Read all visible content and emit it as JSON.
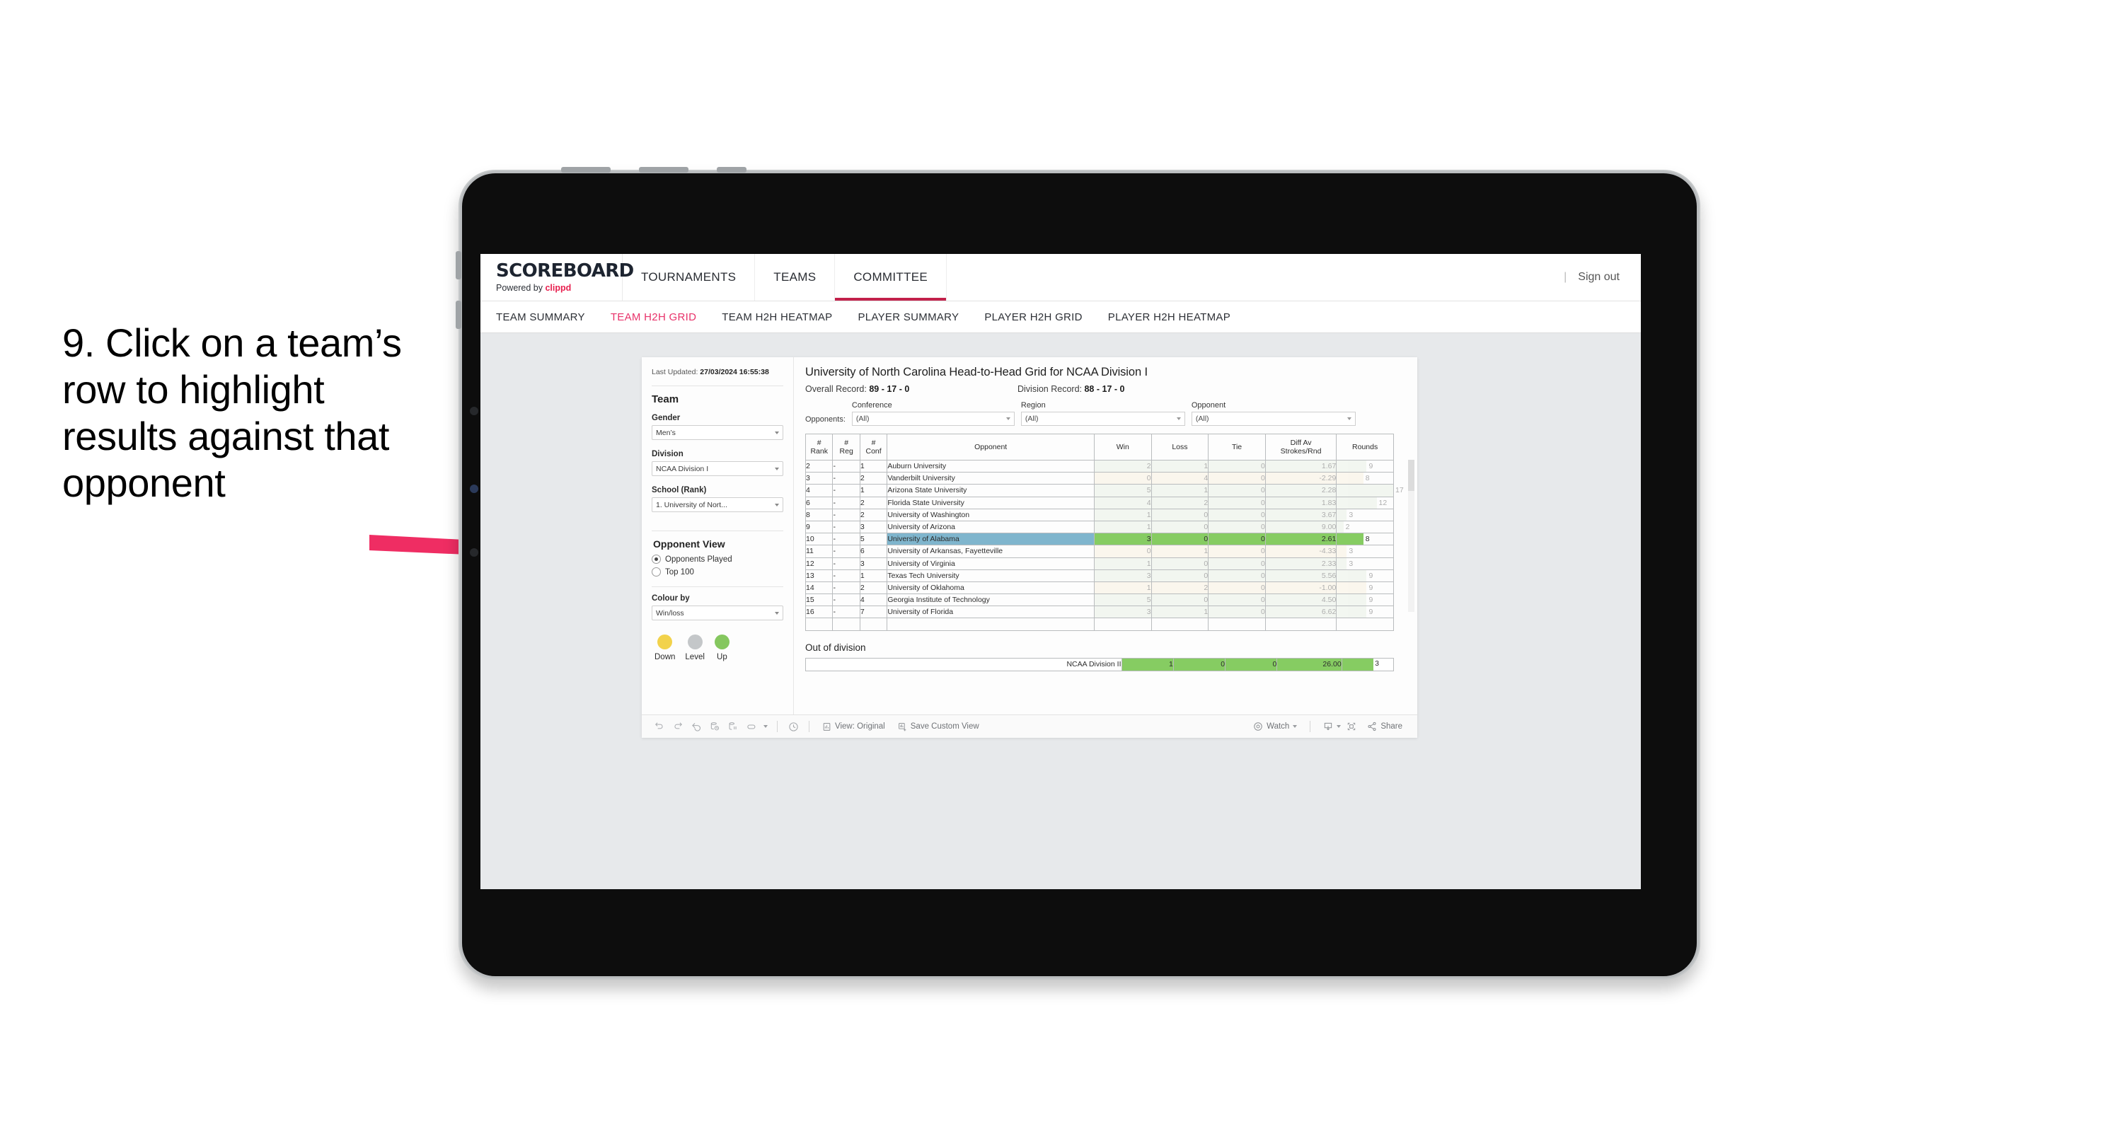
{
  "annotation": {
    "text": "9. Click on a team’s row to highlight results against that opponent"
  },
  "topnav": {
    "brand_title": "SCOREBOARD",
    "brand_sub_prefix": "Powered by ",
    "brand_sub_name": "clippd",
    "items": [
      {
        "label": "TOURNAMENTS",
        "active": false
      },
      {
        "label": "TEAMS",
        "active": false
      },
      {
        "label": "COMMITTEE",
        "active": true
      }
    ],
    "divider": "|",
    "sign_out": "Sign out"
  },
  "subnav": {
    "items": [
      {
        "label": "TEAM SUMMARY",
        "active": false
      },
      {
        "label": "TEAM H2H GRID",
        "active": true
      },
      {
        "label": "TEAM H2H HEATMAP",
        "active": false
      },
      {
        "label": "PLAYER SUMMARY",
        "active": false
      },
      {
        "label": "PLAYER H2H GRID",
        "active": false
      },
      {
        "label": "PLAYER H2H HEATMAP",
        "active": false
      }
    ]
  },
  "sidebar": {
    "last_updated_label": "Last Updated: ",
    "last_updated_value": "27/03/2024 16:55:38",
    "team_heading": "Team",
    "gender_label": "Gender",
    "gender_value": "Men’s",
    "division_label": "Division",
    "division_value": "NCAA Division I",
    "school_label": "School (Rank)",
    "school_value": "1. University of Nort...",
    "opponent_view_heading": "Opponent View",
    "opponent_view_options": [
      {
        "label": "Opponents Played",
        "selected": true
      },
      {
        "label": "Top 100",
        "selected": false
      }
    ],
    "colour_by_label": "Colour by",
    "colour_by_value": "Win/loss",
    "legend": [
      {
        "label": "Down",
        "color": "#f2d24b"
      },
      {
        "label": "Level",
        "color": "#c4c7c9"
      },
      {
        "label": "Up",
        "color": "#85c75f"
      }
    ]
  },
  "main": {
    "title": "University of North Carolina Head-to-Head Grid for NCAA Division I",
    "overall_record_label": "Overall Record: ",
    "overall_record_value": "89 - 17 - 0",
    "division_record_label": "Division Record: ",
    "division_record_value": "88 - 17 - 0",
    "opponents_label": "Opponents:",
    "filters": [
      {
        "label": "Conference",
        "value": "(All)"
      },
      {
        "label": "Region",
        "value": "(All)"
      },
      {
        "label": "Opponent",
        "value": "(All)"
      }
    ],
    "out_of_division_title": "Out of division",
    "out_of_division_row": {
      "label": "NCAA Division II",
      "win": "1",
      "loss": "0",
      "tie": "0",
      "diff": "26.00",
      "rounds": "3"
    }
  },
  "chart_data": {
    "type": "table",
    "title": "University of North Carolina Head-to-Head Grid for NCAA Division I",
    "columns": [
      "# Rank",
      "# Reg",
      "# Conf",
      "Opponent",
      "Win",
      "Loss",
      "Tie",
      "Diff Av Strokes/Rnd",
      "Rounds"
    ],
    "column_header_lines": [
      [
        "#",
        "Rank"
      ],
      [
        "#",
        "Reg"
      ],
      [
        "#",
        "Conf"
      ],
      [
        "Opponent"
      ],
      [
        "Win"
      ],
      [
        "Loss"
      ],
      [
        "Tie"
      ],
      [
        "Diff Av",
        "Strokes/Rnd"
      ],
      [
        "Rounds"
      ]
    ],
    "rows": [
      {
        "rank": "2",
        "reg": "-",
        "conf": "1",
        "opponent": "Auburn University",
        "win": "2",
        "loss": "1",
        "tie": "0",
        "diff": "1.67",
        "rounds": "9",
        "tone": "green",
        "selected": false
      },
      {
        "rank": "3",
        "reg": "-",
        "conf": "2",
        "opponent": "Vanderbilt University",
        "win": "0",
        "loss": "4",
        "tie": "0",
        "diff": "-2.29",
        "rounds": "8",
        "tone": "yellow",
        "selected": false
      },
      {
        "rank": "4",
        "reg": "-",
        "conf": "1",
        "opponent": "Arizona State University",
        "win": "5",
        "loss": "1",
        "tie": "0",
        "diff": "2.28",
        "rounds": "17",
        "tone": "green",
        "selected": false
      },
      {
        "rank": "6",
        "reg": "-",
        "conf": "2",
        "opponent": "Florida State University",
        "win": "4",
        "loss": "2",
        "tie": "0",
        "diff": "1.83",
        "rounds": "12",
        "tone": "green",
        "selected": false
      },
      {
        "rank": "8",
        "reg": "-",
        "conf": "2",
        "opponent": "University of Washington",
        "win": "1",
        "loss": "0",
        "tie": "0",
        "diff": "3.67",
        "rounds": "3",
        "tone": "green",
        "selected": false
      },
      {
        "rank": "9",
        "reg": "-",
        "conf": "3",
        "opponent": "University of Arizona",
        "win": "1",
        "loss": "0",
        "tie": "0",
        "diff": "9.00",
        "rounds": "2",
        "tone": "green",
        "selected": false
      },
      {
        "rank": "10",
        "reg": "-",
        "conf": "5",
        "opponent": "University of Alabama",
        "win": "3",
        "loss": "0",
        "tie": "0",
        "diff": "2.61",
        "rounds": "8",
        "tone": "selected",
        "selected": true
      },
      {
        "rank": "11",
        "reg": "-",
        "conf": "6",
        "opponent": "University of Arkansas, Fayetteville",
        "win": "0",
        "loss": "1",
        "tie": "0",
        "diff": "-4.33",
        "rounds": "3",
        "tone": "yellow",
        "selected": false
      },
      {
        "rank": "12",
        "reg": "-",
        "conf": "3",
        "opponent": "University of Virginia",
        "win": "1",
        "loss": "0",
        "tie": "0",
        "diff": "2.33",
        "rounds": "3",
        "tone": "green",
        "selected": false
      },
      {
        "rank": "13",
        "reg": "-",
        "conf": "1",
        "opponent": "Texas Tech University",
        "win": "3",
        "loss": "0",
        "tie": "0",
        "diff": "5.56",
        "rounds": "9",
        "tone": "green",
        "selected": false
      },
      {
        "rank": "14",
        "reg": "-",
        "conf": "2",
        "opponent": "University of Oklahoma",
        "win": "1",
        "loss": "2",
        "tie": "0",
        "diff": "-1.00",
        "rounds": "9",
        "tone": "yellow",
        "selected": false
      },
      {
        "rank": "15",
        "reg": "-",
        "conf": "4",
        "opponent": "Georgia Institute of Technology",
        "win": "5",
        "loss": "0",
        "tie": "0",
        "diff": "4.50",
        "rounds": "9",
        "tone": "green",
        "selected": false
      },
      {
        "rank": "16",
        "reg": "-",
        "conf": "7",
        "opponent": "University of Florida",
        "win": "3",
        "loss": "1",
        "tie": "0",
        "diff": "6.62",
        "rounds": "9",
        "tone": "green",
        "selected": false
      }
    ],
    "out_of_division": [
      {
        "label": "NCAA Division II",
        "win": "1",
        "loss": "0",
        "tie": "0",
        "diff": "26.00",
        "rounds": "3"
      }
    ],
    "colors": {
      "green_soft": "#e2ecdc",
      "yellow_soft": "#f7edd4",
      "green_strong": "#86cc62",
      "selected_row": "#7fb5cd",
      "accent": "#e8326a"
    }
  },
  "toolbar": {
    "view_label": "View: Original",
    "save_label": "Save Custom View",
    "watch_label": "Watch",
    "share_label": "Share"
  }
}
